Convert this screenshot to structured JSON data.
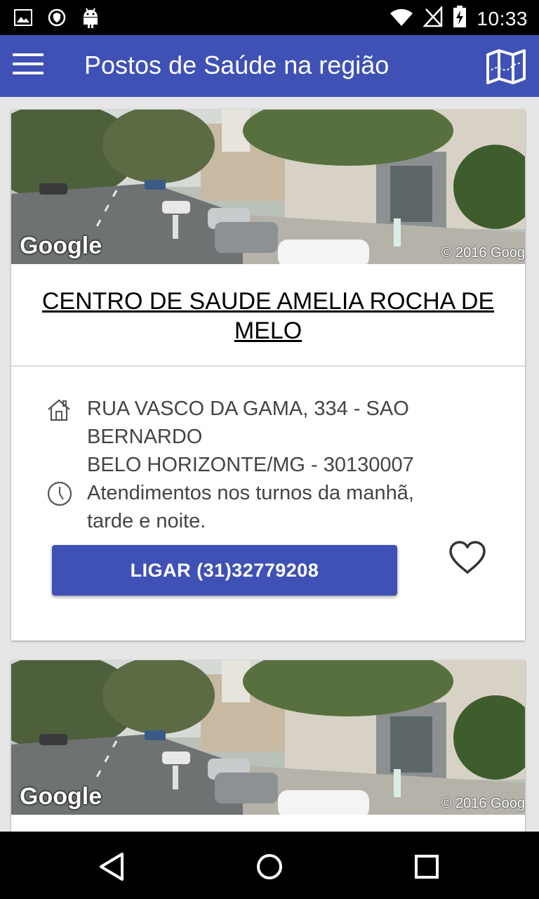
{
  "status_bar": {
    "time": "10:33",
    "icons": [
      "image-icon",
      "shield-icon",
      "android-icon",
      "wifi-icon",
      "no-signal-icon",
      "battery-charging-icon"
    ]
  },
  "app_bar": {
    "title": "Postos de Saúde na região",
    "menu_icon": "hamburger-menu-icon",
    "map_icon": "map-icon",
    "color": "#3f51b5"
  },
  "cards": [
    {
      "image": {
        "watermark": "Google",
        "copyright": "© 2016 Goog"
      },
      "name": "CENTRO DE SAUDE AMELIA ROCHA DE MELO",
      "address_line1": "RUA VASCO DA GAMA, 334 - SAO BERNARDO",
      "address_line2": "BELO HORIZONTE/MG - 30130007",
      "hours": "Atendimentos nos turnos da manhã, tarde e noite.",
      "call_label": "LIGAR (31)32779208",
      "address_icon": "home-icon",
      "hours_icon": "clock-icon",
      "favorite_icon": "heart-outline-icon"
    },
    {
      "image": {
        "watermark": "Google",
        "copyright": "© 2016 Goog"
      }
    }
  ],
  "nav_bar": {
    "buttons": [
      "back-icon",
      "home-circle-icon",
      "recents-icon"
    ]
  }
}
